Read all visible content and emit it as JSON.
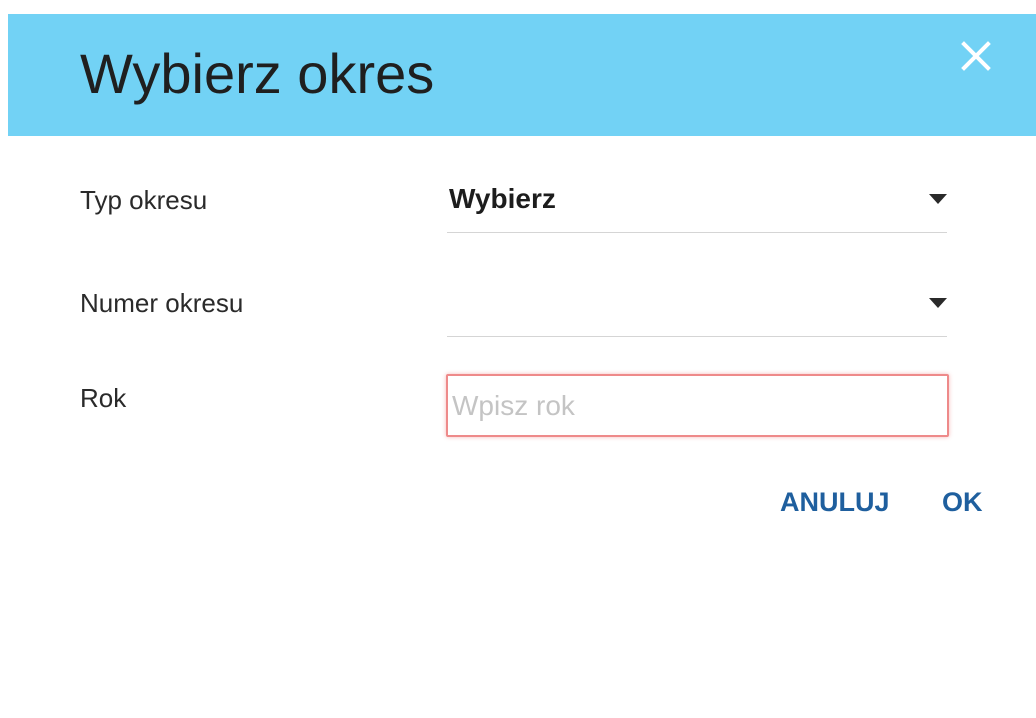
{
  "dialog": {
    "title": "Wybierz okres",
    "close_icon": "close-icon",
    "header_color": "#72d2f5"
  },
  "form": {
    "period_type": {
      "label": "Typ okresu",
      "value": "Wybierz"
    },
    "period_number": {
      "label": "Numer okresu",
      "value": ""
    },
    "year": {
      "label": "Rok",
      "value": "",
      "placeholder": "Wpisz rok"
    }
  },
  "actions": {
    "cancel_label": "ANULUJ",
    "ok_label": "OK",
    "accent_color": "#1f5f9e"
  }
}
